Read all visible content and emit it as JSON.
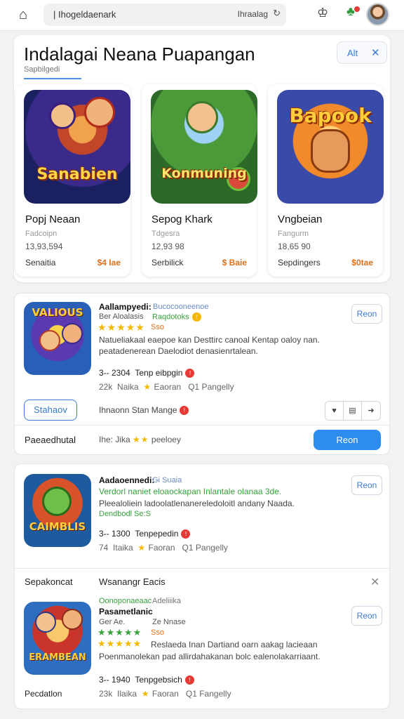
{
  "topbar": {
    "url": "| Ihogeldaenark",
    "url_right": "Ihraalag",
    "icons": [
      "home-icon",
      "reload-icon",
      "store-icon",
      "notification-icon",
      "avatar"
    ]
  },
  "hero": {
    "title": "Indalagai Neana Puapangan",
    "subtitle": "Sapbilgedi",
    "alt_label": "Alt",
    "alt_close": "✕",
    "cards": [
      {
        "image_text": "Sanabien",
        "name": "Popj Neaan",
        "dev": "Fadcoipn",
        "count": "13,93,594",
        "category": "Senaitia",
        "price": "$4 Iae"
      },
      {
        "image_text": "Konmuning",
        "name": "Sepog Khark",
        "dev": "Tdgesra",
        "count": "12,93 98",
        "category": "Serbilick",
        "price": "$ Baie"
      },
      {
        "image_text": "Bapook",
        "name": "Vngbeian",
        "dev": "Fangurm",
        "count": "18,65 90",
        "category": "Sepdingers",
        "price": "$0tae"
      }
    ]
  },
  "panel1": {
    "icon_text": "VALIOUS",
    "title": "Aallampyedi:",
    "title_extra": "Bucocooneenoe",
    "sub_left": "Ber Aloalasis",
    "sub_right": "Raqdotoks",
    "stars": "★★★★★",
    "rating": "Sso",
    "desc1": "Natueliakaal eaepoe kan Desttirc canoal Kentap oaloy nan.",
    "desc2": "peatadenerean Daelodiot denasienrtalean.",
    "meta1_num": "3-- 2304",
    "meta1_text": "Tenp eibpgin",
    "meta2_num": "22k",
    "meta2_text": "Naika",
    "meta2_star": "★",
    "meta2_b": "Eaoran",
    "meta2_c": "Q1 Pangelly",
    "get": "Reon",
    "btn_outline": "Stahaov",
    "action_text": "Ihnaonn Stan Mange",
    "seg": [
      "♥",
      "▤",
      "➜"
    ],
    "footer_left": "Paeaedhutal",
    "footer_mid": "Ihe: Jika",
    "footer_stars": "★★",
    "footer_tail": "peeloey",
    "primary": "Reon"
  },
  "panel2": {
    "icon_text": "CAIMBLIS",
    "title": "Aadaoennedi:",
    "title_extra": "Gi Suaia",
    "line_green": "Verdorl naniet eloaockapan Inlantale olanaa 3de.",
    "desc": "Pleealoliein ladoolatlenanereledoloitl andany Naada.",
    "green2": "Dendbodl Se:S",
    "meta1_num": "3-- 1300",
    "meta1_text": "Tenpepedin",
    "meta2_num": "74",
    "meta2_text": "Itaika",
    "meta2_star": "★",
    "meta2_b": "Faoran",
    "meta2_c": "Q1 Pangelly",
    "get": "Reon",
    "section_left": "Sepakoncat",
    "section_mid": "Wsanangr Eacis",
    "section_close": "✕",
    "sub_icon_text": "ERAMBEAN",
    "sub_title_green": "Oonoponaeaac",
    "sub_title_extra": "Adeliiika",
    "sub_title": "Pasametlanic",
    "sub_line": "Ger Ae.",
    "sub_line2": "Ze Nnase",
    "sub_stars1": "★★★★★",
    "sub_rating": "Sso",
    "sub_stars2": "★★★★★",
    "sub_desc1": "Reslaeda Inan Dartiand oarn aakag lacieaan",
    "sub_desc2": "Poenmanolekan pad allirdahakanan bolc ealenolakarriaant.",
    "sub_meta1_num": "3-- 1940",
    "sub_meta1_text": "Tenpgebsich",
    "sub_meta2_num": "23k",
    "sub_meta2_text": "Ilaika",
    "sub_meta2_star": "★",
    "sub_meta2_b": "Faoran",
    "sub_meta2_c": "Q1 Fangelly",
    "sub_get": "Reon",
    "sub_footer": "Pecdatlon"
  }
}
